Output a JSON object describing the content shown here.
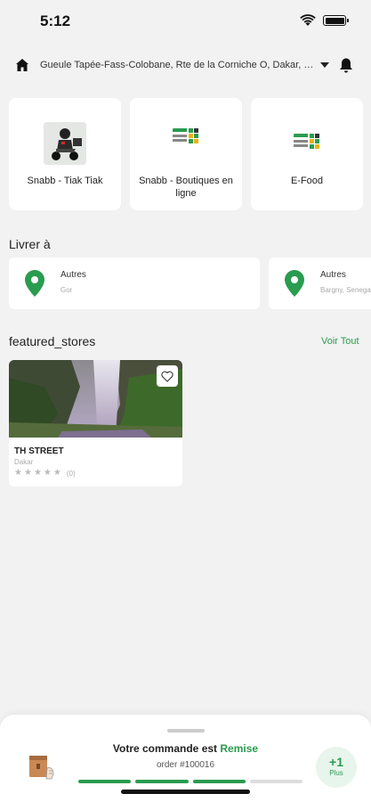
{
  "status_bar": {
    "time": "5:12"
  },
  "header": {
    "address": "Gueule Tapée-Fass-Colobane, Rte de la Corniche O, Dakar, Sénégal"
  },
  "modules": [
    {
      "label": "Snabb - Tiak Tiak",
      "icon": "delivery-rider-image"
    },
    {
      "label": "Snabb - Boutiques en ligne",
      "icon": "shop-logo-image"
    },
    {
      "label": "E-Food",
      "icon": "shop-logo-image"
    }
  ],
  "delivery": {
    "title": "Livrer à",
    "addresses": [
      {
        "type": "Autres",
        "detail": "Gor"
      },
      {
        "type": "Autres",
        "detail": "Bargny, Senegal"
      }
    ]
  },
  "featured": {
    "title": "featured_stores",
    "see_all": "Voir Tout",
    "stores": [
      {
        "name": "TH STREET",
        "city": "Dakar",
        "rating": 0,
        "rating_count": "(0)"
      }
    ]
  },
  "order_sheet": {
    "status_prefix": "Votre commande est",
    "status_word": "Remise",
    "order_number": "order #100016",
    "progress_steps_done": 3,
    "progress_steps_total": 4,
    "more_count": "+1",
    "more_label": "Plus"
  },
  "colors": {
    "accent": "#2a9c4f",
    "background": "#f2f2f2"
  }
}
